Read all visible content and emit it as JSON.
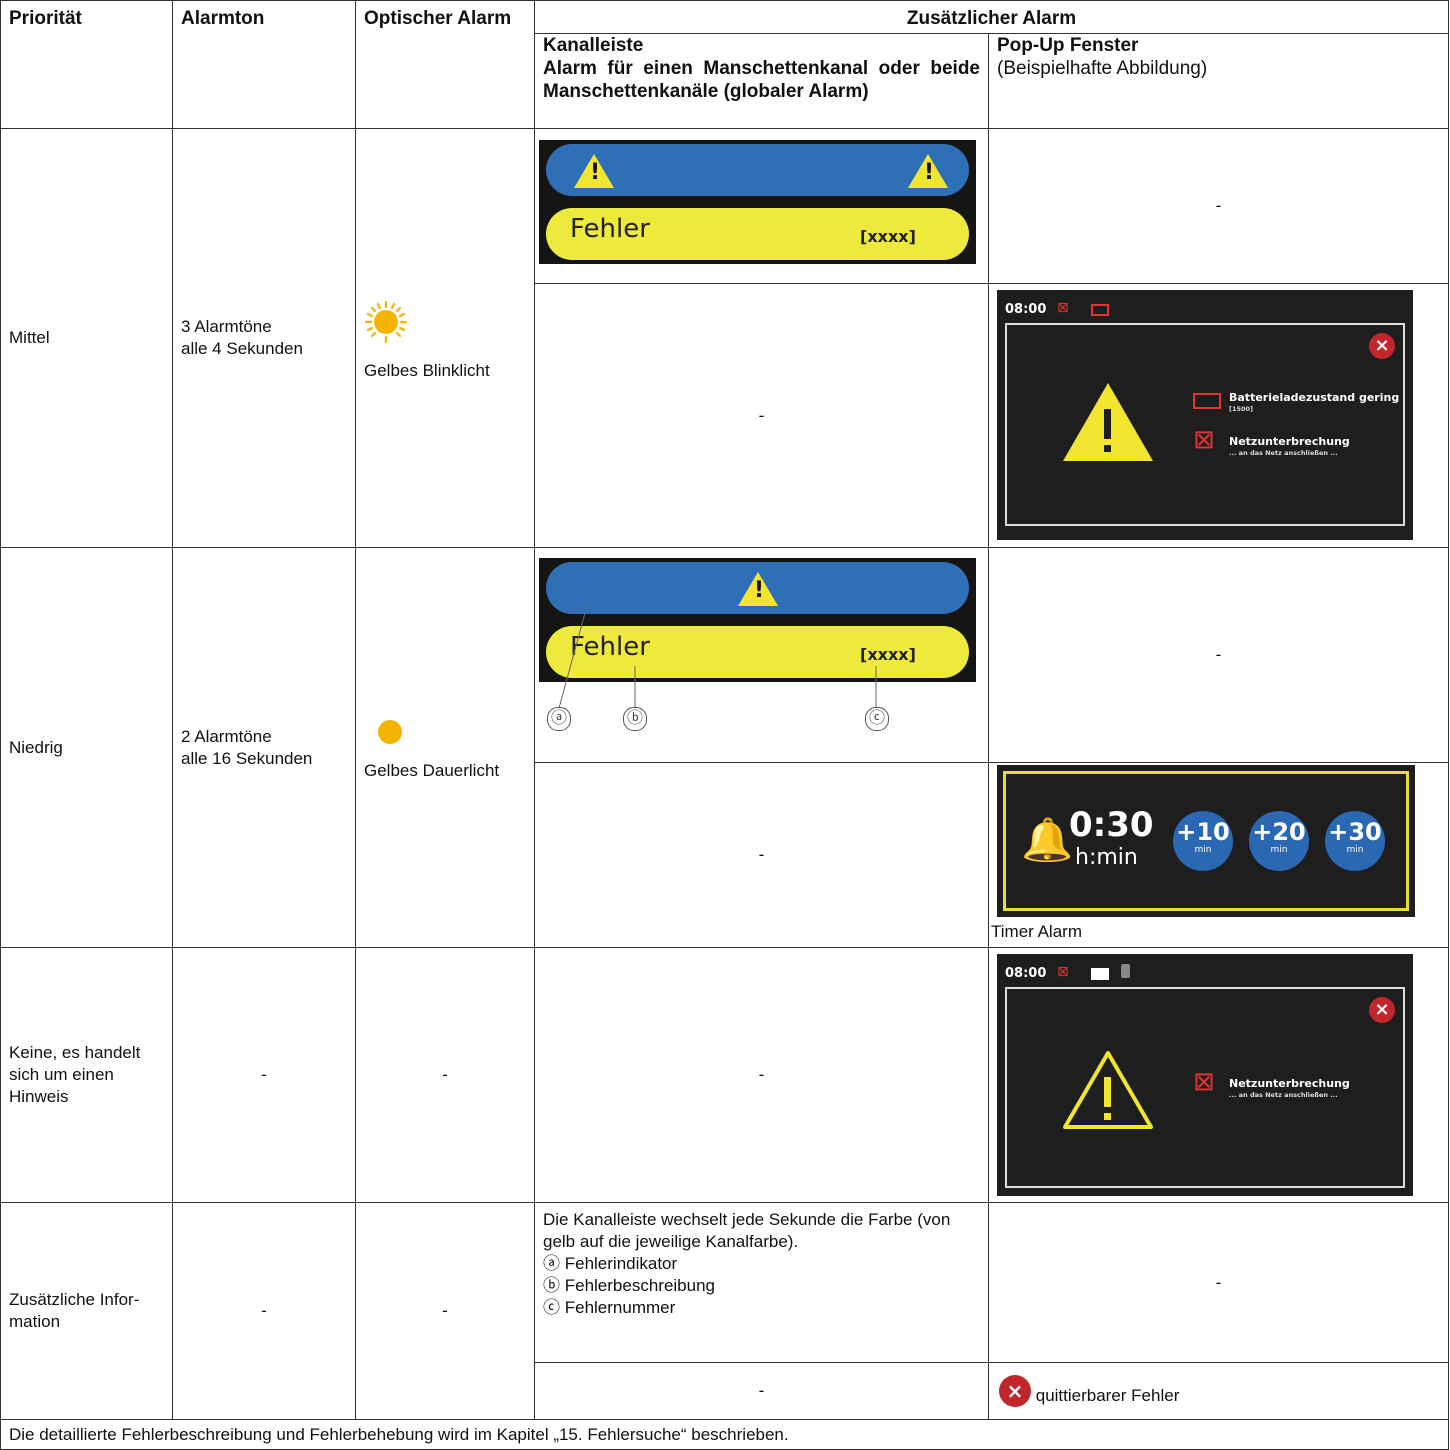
{
  "headers": {
    "prioritaet": "Priorität",
    "alarmton": "Alarmton",
    "optisch": "Optischer Alarm",
    "zusatz": "Zusätzlicher Alarm",
    "kanalleiste_title": "Kanalleiste",
    "kanalleiste_desc": "Alarm für einen Manschettenkanal oder beide Manschettenkanäle (globaler Alarm)",
    "popup_title": "Pop-Up Fenster",
    "popup_desc": "(Beispielhafte Abbildung)"
  },
  "dash": "-",
  "channel_bar": {
    "error_text": "Fehler",
    "error_code": "[xxxx]"
  },
  "rows": {
    "mittel": {
      "priority": "Mittel",
      "tone_line1": "3 Alarmtöne",
      "tone_line2": "alle 4 Sekunden",
      "optical": "Gelbes Blinklicht"
    },
    "niedrig": {
      "priority": "Niedrig",
      "tone_line1": "2 Alarmtöne",
      "tone_line2": "alle 16 Sekunden",
      "optical": "Gelbes Dauerlicht"
    },
    "hinweis": {
      "priority_line1": "Keine, es handelt",
      "priority_line2": "sich um einen",
      "priority_line3": "Hinweis"
    },
    "info": {
      "priority_line1": "Zusätzliche Infor-",
      "priority_line2": "mation",
      "desc_line1": "Die Kanalleiste wechselt jede Sekunde die Farbe (von",
      "desc_line2": "gelb auf die jeweilige Kanalfarbe).",
      "legend": [
        {
          "marker": "ⓐ",
          "label": "Fehlerindikator"
        },
        {
          "marker": "ⓑ",
          "label": "Fehlerbeschreibung"
        },
        {
          "marker": "ⓒ",
          "label": "Fehlernummer"
        }
      ],
      "ack_label": "quittierbarer Fehler"
    }
  },
  "popup1": {
    "time": "08:00",
    "msg1": "Batterieladezustand gering",
    "msg1_sub": "[1500]",
    "msg2": "Netzunterbrechung",
    "msg2_sub": "... an das Netz anschließen ..."
  },
  "popup2": {
    "time": "08:00",
    "msg": "Netzunterbrechung",
    "msg_sub": "... an das Netz anschließen ..."
  },
  "timer": {
    "time": "0:30",
    "unit": "h:min",
    "buttons": [
      {
        "value": "+10",
        "unit": "min"
      },
      {
        "value": "+20",
        "unit": "min"
      },
      {
        "value": "+30",
        "unit": "min"
      }
    ],
    "caption": "Timer Alarm"
  },
  "footer": "Die detaillierte Fehlerbeschreibung und Fehlerbehebung wird im Kapitel „15. Fehlersuche“ beschrieben.",
  "colors": {
    "blue_bar": "#2f6fb5",
    "yellow_bar": "#eeea3d",
    "alarm_red": "#c0262b",
    "warning_yellow": "#f2e52f"
  }
}
